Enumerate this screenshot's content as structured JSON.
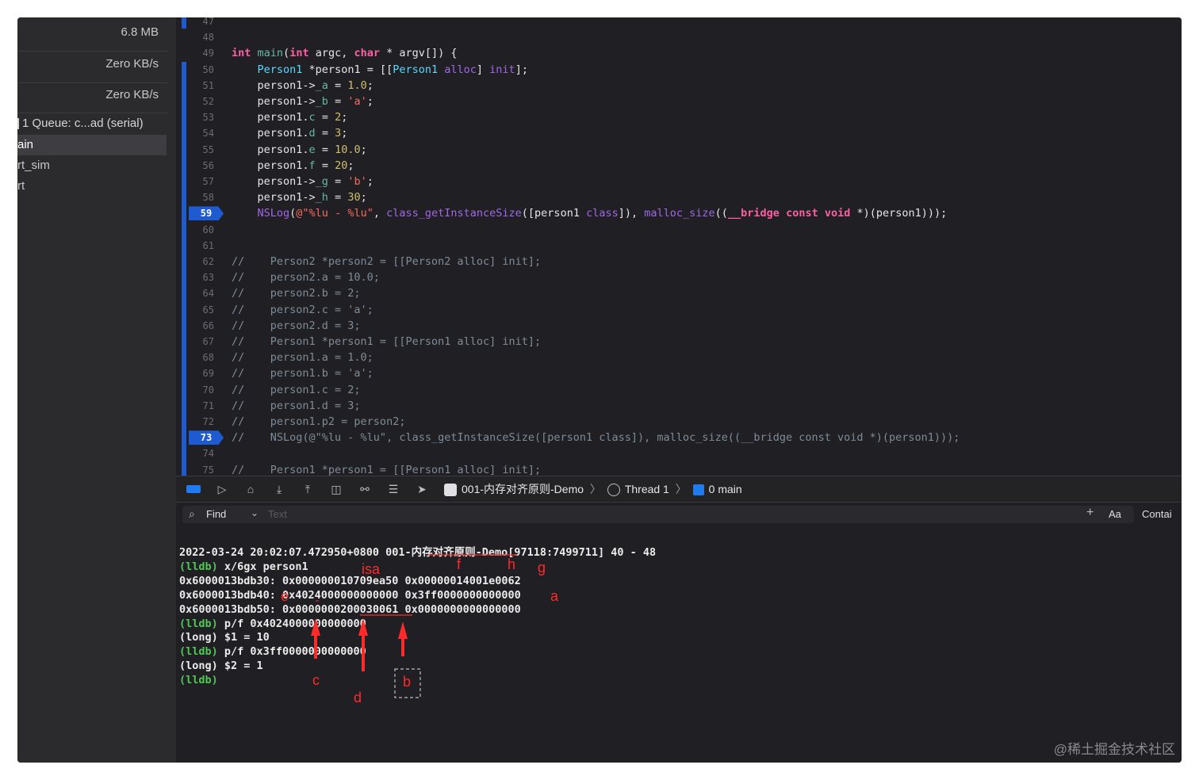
{
  "sidebar": {
    "memory": "6.8 MB",
    "net_in": "Zero KB/s",
    "net_out": "Zero KB/s",
    "thread": "1 Queue: c...ad (serial)",
    "frames": [
      "ain",
      "rt_sim",
      "rt"
    ]
  },
  "editor": {
    "lines": [
      {
        "n": "47",
        "html": ""
      },
      {
        "n": "48",
        "html": ""
      },
      {
        "n": "49",
        "html": "<span class='kw'>int</span> <span class='fn'>main</span>(<span class='kw'>int</span> argc, <span class='kw'>char</span> * argv[]) {"
      },
      {
        "n": "50",
        "html": "    <span class='cl'>Person1</span> *person1 = [[<span class='cl'>Person1</span> <span class='ty2'>alloc</span>] <span class='ty2'>init</span>];"
      },
      {
        "n": "51",
        "html": "    person1-&gt;<span class='fn'>_a</span> = <span class='num'>1.0</span>;"
      },
      {
        "n": "52",
        "html": "    person1-&gt;<span class='fn'>_b</span> = <span class='str'>'a'</span>;"
      },
      {
        "n": "53",
        "html": "    person1.<span class='fn'>c</span> = <span class='num'>2</span>;"
      },
      {
        "n": "54",
        "html": "    person1.<span class='fn'>d</span> = <span class='num'>3</span>;"
      },
      {
        "n": "55",
        "html": "    person1.<span class='fn'>e</span> = <span class='num'>10.0</span>;"
      },
      {
        "n": "56",
        "html": "    person1.<span class='fn'>f</span> = <span class='num'>20</span>;"
      },
      {
        "n": "57",
        "html": "    person1-&gt;<span class='fn'>_g</span> = <span class='str'>'b'</span>;"
      },
      {
        "n": "58",
        "html": "    person1-&gt;<span class='fn'>_h</span> = <span class='num'>30</span>;"
      },
      {
        "n": "59",
        "bp": true,
        "html": "    <span class='ty2'>NSLog</span>(<span class='str'>@\"%lu - %lu\"</span>, <span class='ty2'>class_getInstanceSize</span>([person1 <span class='ty2'>class</span>]), <span class='ty2'>malloc_size</span>((<span class='kw'>__bridge</span> <span class='kw'>const</span> <span class='kw'>void</span> *)(person1)));"
      },
      {
        "n": "60",
        "html": ""
      },
      {
        "n": "61",
        "html": ""
      },
      {
        "n": "62",
        "html": "<span class='cm'>//    Person2 *person2 = [[Person2 alloc] init];</span>"
      },
      {
        "n": "63",
        "html": "<span class='cm'>//    person2.a = 10.0;</span>"
      },
      {
        "n": "64",
        "html": "<span class='cm'>//    person2.b = 2;</span>"
      },
      {
        "n": "65",
        "html": "<span class='cm'>//    person2.c = 'a';</span>"
      },
      {
        "n": "66",
        "html": "<span class='cm'>//    person2.d = 3;</span>"
      },
      {
        "n": "67",
        "html": "<span class='cm'>//    Person1 *person1 = [[Person1 alloc] init];</span>"
      },
      {
        "n": "68",
        "html": "<span class='cm'>//    person1.a = 1.0;</span>"
      },
      {
        "n": "69",
        "html": "<span class='cm'>//    person1.b = 'a';</span>"
      },
      {
        "n": "70",
        "html": "<span class='cm'>//    person1.c = 2;</span>"
      },
      {
        "n": "71",
        "html": "<span class='cm'>//    person1.d = 3;</span>"
      },
      {
        "n": "72",
        "html": "<span class='cm'>//    person1.p2 = person2;</span>"
      },
      {
        "n": "73",
        "bp": true,
        "html": "<span class='cm'>//    NSLog(@\"%lu - %lu\", class_getInstanceSize([person1 class]), malloc_size((__bridge const void *)(person1)));</span>"
      },
      {
        "n": "74",
        "html": ""
      },
      {
        "n": "75",
        "html": "<span class='cm'>//    Person1 *person1 = [[Person1 alloc] init];</span>"
      }
    ]
  },
  "debugbar": {
    "target": "001-内存对齐原则-Demo",
    "thread": "Thread 1",
    "frame": "0 main"
  },
  "find": {
    "label": "Find",
    "placeholder": "Text",
    "case": "Aa",
    "mode": "Contai"
  },
  "console": {
    "lines": [
      {
        "prompt": "",
        "text": "2022-03-24 20:02:07.472950+0800 001-内存对齐原则-Demo[97118:7499711] 40 - 48"
      },
      {
        "prompt": "(lldb)",
        "text": " x/6gx person1"
      },
      {
        "prompt": "",
        "text": "0x6000013bdb30: 0x000000010709ea50 0x00000014001e0062"
      },
      {
        "prompt": "",
        "text": "0x6000013bdb40: 0x4024000000000000 0x3ff0000000000000"
      },
      {
        "prompt": "",
        "text": "0x6000013bdb50: 0x0000000200030061 0x0000000000000000"
      },
      {
        "prompt": "(lldb)",
        "text": " p/f 0x4024000000000000"
      },
      {
        "prompt": "",
        "text": "(long) $1 = 10"
      },
      {
        "prompt": "(lldb)",
        "text": " p/f 0x3ff0000000000000"
      },
      {
        "prompt": "",
        "text": "(long) $2 = 1"
      },
      {
        "prompt": "(lldb)",
        "text": ""
      }
    ],
    "annotations": {
      "isa": "isa",
      "f": "f",
      "h": "h",
      "g": "g",
      "e": "e",
      "a": "a",
      "c": "c",
      "d": "d",
      "b": "b"
    }
  },
  "watermark": "@稀土掘金技术社区",
  "colors": {
    "accent": "#1f5bd0",
    "annotation": "#ff2a2a",
    "lldb_prompt": "#4ec952"
  }
}
